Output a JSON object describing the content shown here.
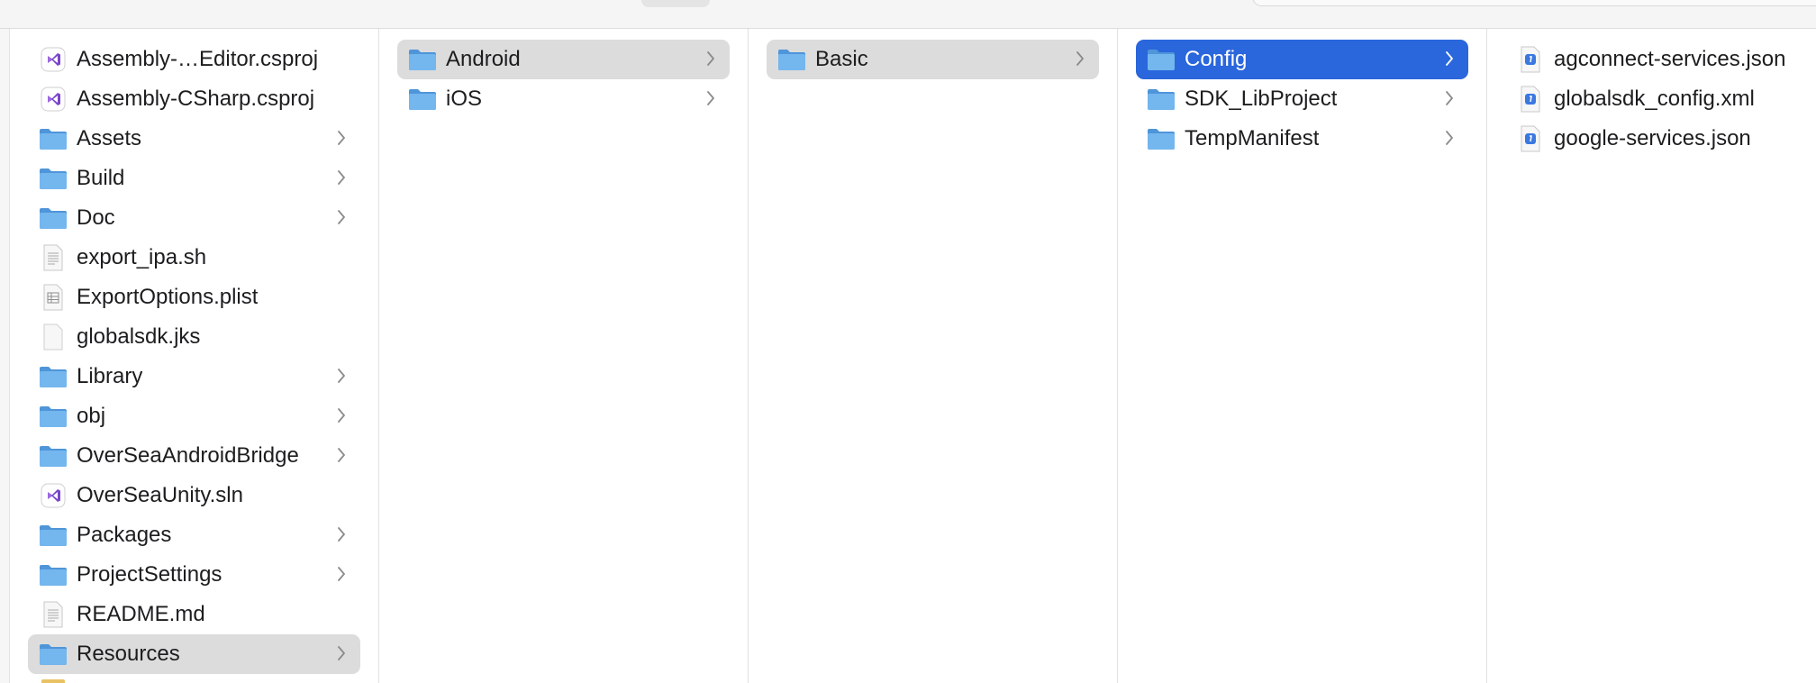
{
  "columns": [
    {
      "items": [
        {
          "label": "Assembly-…Editor.csproj",
          "icon": "vs-solution-icon",
          "has_children": false,
          "state": ""
        },
        {
          "label": "Assembly-CSharp.csproj",
          "icon": "vs-solution-icon",
          "has_children": false,
          "state": ""
        },
        {
          "label": "Assets",
          "icon": "folder-icon",
          "has_children": true,
          "state": ""
        },
        {
          "label": "Build",
          "icon": "folder-icon",
          "has_children": true,
          "state": ""
        },
        {
          "label": "Doc",
          "icon": "folder-icon",
          "has_children": true,
          "state": ""
        },
        {
          "label": "export_ipa.sh",
          "icon": "text-file-icon",
          "has_children": false,
          "state": ""
        },
        {
          "label": "ExportOptions.plist",
          "icon": "plist-file-icon",
          "has_children": false,
          "state": ""
        },
        {
          "label": "globalsdk.jks",
          "icon": "blank-file-icon",
          "has_children": false,
          "state": ""
        },
        {
          "label": "Library",
          "icon": "folder-icon",
          "has_children": true,
          "state": ""
        },
        {
          "label": "obj",
          "icon": "folder-icon",
          "has_children": true,
          "state": ""
        },
        {
          "label": "OverSeaAndroidBridge",
          "icon": "folder-icon",
          "has_children": true,
          "state": ""
        },
        {
          "label": "OverSeaUnity.sln",
          "icon": "vs-solution-icon",
          "has_children": false,
          "state": ""
        },
        {
          "label": "Packages",
          "icon": "folder-icon",
          "has_children": true,
          "state": ""
        },
        {
          "label": "ProjectSettings",
          "icon": "folder-icon",
          "has_children": true,
          "state": ""
        },
        {
          "label": "README.md",
          "icon": "text-file-icon",
          "has_children": false,
          "state": ""
        },
        {
          "label": "Resources",
          "icon": "folder-icon",
          "has_children": true,
          "state": "path"
        }
      ]
    },
    {
      "items": [
        {
          "label": "Android",
          "icon": "folder-icon",
          "has_children": true,
          "state": "path"
        },
        {
          "label": "iOS",
          "icon": "folder-icon",
          "has_children": true,
          "state": ""
        }
      ]
    },
    {
      "items": [
        {
          "label": "Basic",
          "icon": "folder-icon",
          "has_children": true,
          "state": "path"
        }
      ]
    },
    {
      "items": [
        {
          "label": "Config",
          "icon": "folder-icon",
          "has_children": true,
          "state": "selected"
        },
        {
          "label": "SDK_LibProject",
          "icon": "folder-icon",
          "has_children": true,
          "state": ""
        },
        {
          "label": "TempManifest",
          "icon": "folder-icon",
          "has_children": true,
          "state": ""
        }
      ]
    },
    {
      "items": [
        {
          "label": "agconnect-services.json",
          "icon": "json-file-icon",
          "has_children": false,
          "state": ""
        },
        {
          "label": "globalsdk_config.xml",
          "icon": "json-file-icon",
          "has_children": false,
          "state": ""
        },
        {
          "label": "google-services.json",
          "icon": "json-file-icon",
          "has_children": false,
          "state": ""
        }
      ]
    }
  ],
  "colors": {
    "selected_blue": "#2a66dc",
    "path_grey": "#dcdcdc",
    "folder_blue": "#5fa8e8",
    "vs_purple": "#8a5bd6"
  }
}
